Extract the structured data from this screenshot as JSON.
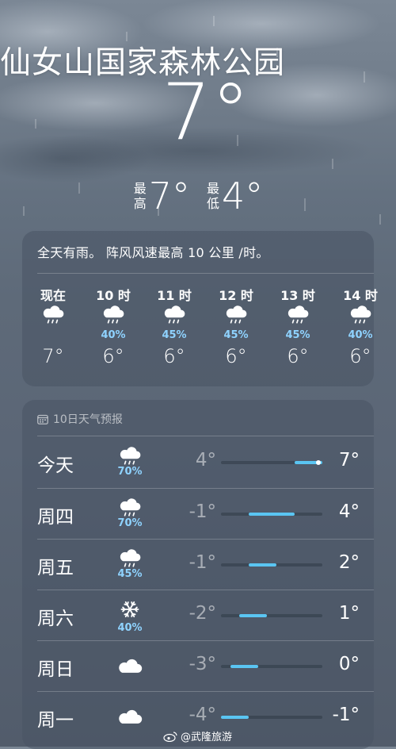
{
  "location": "仙女山国家森林公园",
  "current_temp": "7°",
  "high_label": "最高",
  "high_temp": "7°",
  "low_label": "最低",
  "low_temp": "4°",
  "hourly": {
    "summary": "全天有雨。 阵风风速最高 10 公里 /时。",
    "items": [
      {
        "time": "现在",
        "icon": "rain-cloud-icon",
        "pct": "",
        "temp": "7°"
      },
      {
        "time": "10 时",
        "icon": "rain-cloud-icon",
        "pct": "40%",
        "temp": "6°"
      },
      {
        "time": "11 时",
        "icon": "rain-cloud-icon",
        "pct": "45%",
        "temp": "6°"
      },
      {
        "time": "12 时",
        "icon": "rain-cloud-icon",
        "pct": "45%",
        "temp": "6°"
      },
      {
        "time": "13 时",
        "icon": "rain-cloud-icon",
        "pct": "45%",
        "temp": "6°"
      },
      {
        "time": "14 时",
        "icon": "rain-cloud-icon",
        "pct": "40%",
        "temp": "6°"
      }
    ]
  },
  "forecast": {
    "title": "10日天气预报",
    "range": [
      -4,
      7
    ],
    "days": [
      {
        "day": "今天",
        "icon": "rain-cloud-icon",
        "pct": "70%",
        "low": "4°",
        "high": "7°",
        "low_v": 4,
        "high_v": 7,
        "current_v": 7
      },
      {
        "day": "周四",
        "icon": "rain-cloud-icon",
        "pct": "70%",
        "low": "-1°",
        "high": "4°",
        "low_v": -1,
        "high_v": 4
      },
      {
        "day": "周五",
        "icon": "rain-cloud-icon",
        "pct": "45%",
        "low": "-1°",
        "high": "2°",
        "low_v": -1,
        "high_v": 2
      },
      {
        "day": "周六",
        "icon": "snowflake-icon",
        "pct": "40%",
        "low": "-2°",
        "high": "1°",
        "low_v": -2,
        "high_v": 1
      },
      {
        "day": "周日",
        "icon": "cloud-icon",
        "pct": "",
        "low": "-3°",
        "high": "0°",
        "low_v": -3,
        "high_v": 0
      },
      {
        "day": "周一",
        "icon": "cloud-icon",
        "pct": "",
        "low": "-4°",
        "high": "-1°",
        "low_v": -4,
        "high_v": -1
      }
    ]
  },
  "colors": {
    "accent": "#5ac5f2",
    "precip": "#8fd3ff"
  },
  "watermark": "@武隆旅游"
}
